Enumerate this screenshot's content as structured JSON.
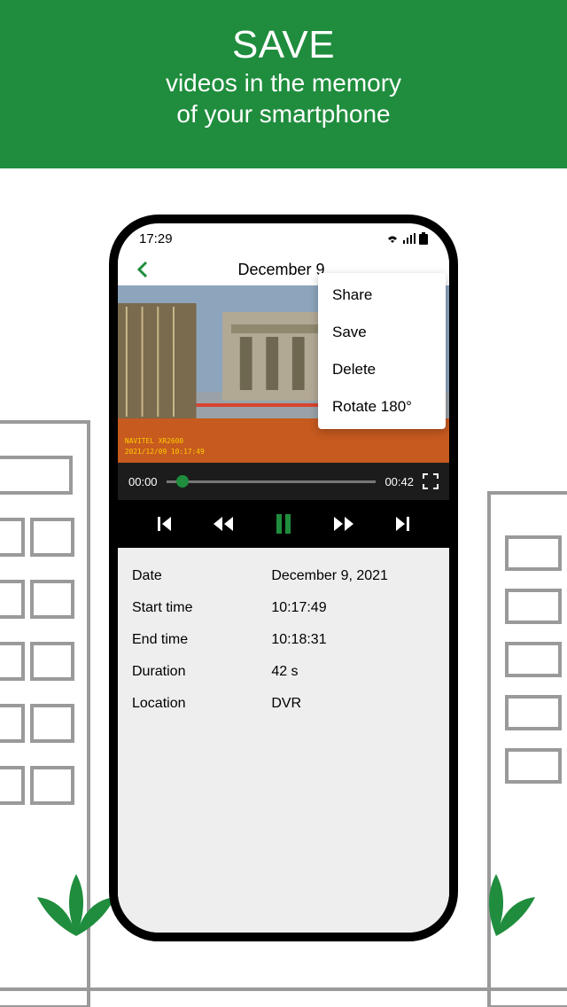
{
  "hero": {
    "title": "SAVE",
    "line1": "videos in the memory",
    "line2": "of your smartphone"
  },
  "status": {
    "time": "17:29"
  },
  "nav": {
    "title": "December 9,"
  },
  "menu": {
    "share": "Share",
    "save": "Save",
    "delete": "Delete",
    "rotate": "Rotate 180°"
  },
  "player": {
    "elapsed": "00:00",
    "total": "00:42"
  },
  "details": {
    "labels": {
      "date": "Date",
      "start": "Start time",
      "end": "End time",
      "duration": "Duration",
      "location": "Location"
    },
    "values": {
      "date": "December 9, 2021",
      "start": "10:17:49",
      "end": "10:18:31",
      "duration": "42 s",
      "location": "DVR"
    }
  },
  "colors": {
    "brand": "#1f8d3d"
  }
}
